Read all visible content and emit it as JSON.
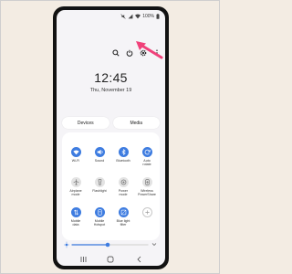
{
  "status": {
    "battery": "100%"
  },
  "clock": "12:45",
  "date": "Thu, November 19",
  "tabs": {
    "devices": "Devices",
    "media": "Media"
  },
  "accent_color": "#3e7ce0",
  "annotation_color": "#f0417a",
  "tiles": [
    {
      "label": "Wi-Fi",
      "icon": "wifi-icon",
      "state": "on"
    },
    {
      "label": "Sound",
      "icon": "sound-icon",
      "state": "on"
    },
    {
      "label": "Bluetooth",
      "icon": "bluetooth-icon",
      "state": "on"
    },
    {
      "label": "Auto\nrotate",
      "icon": "rotate-icon",
      "state": "on"
    },
    {
      "label": "Airplane\nmode",
      "icon": "airplane-icon",
      "state": "off"
    },
    {
      "label": "Flashlight",
      "icon": "flashlight-icon",
      "state": "off"
    },
    {
      "label": "Power\nmode",
      "icon": "power-mode-icon",
      "state": "off"
    },
    {
      "label": "Wireless\nPowerShare",
      "icon": "power-share-icon",
      "state": "off"
    },
    {
      "label": "Mobile\ndata",
      "icon": "mobile-data-icon",
      "state": "on"
    },
    {
      "label": "Mobile\nHotspot",
      "icon": "hotspot-icon",
      "state": "on"
    },
    {
      "label": "Blue light\nfilter",
      "icon": "blue-light-icon",
      "state": "on"
    },
    {
      "label": "",
      "icon": "add-icon",
      "state": "add"
    }
  ],
  "brightness": {
    "level": 0.47
  }
}
